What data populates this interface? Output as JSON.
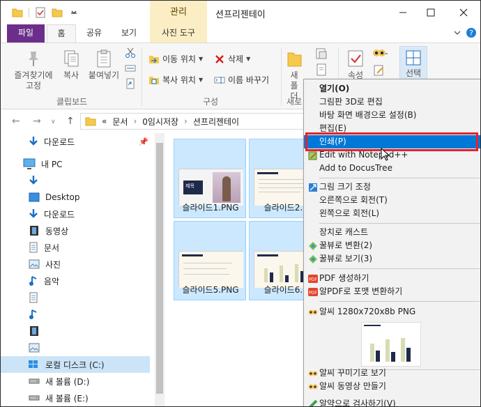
{
  "window": {
    "title": "션프리젠테이",
    "context_tab_group": "관리"
  },
  "tabs": [
    {
      "label": "파일"
    },
    {
      "label": "홈"
    },
    {
      "label": "공유"
    },
    {
      "label": "보기"
    },
    {
      "label": "사진 도구"
    }
  ],
  "ribbon": {
    "pin_label": "즐겨찾기에 고정",
    "copy_label": "복사",
    "paste_label": "붙여넣기",
    "clipboard_group": "클립보드",
    "move_label": "이동 위치",
    "copyto_label": "복사 위치",
    "delete_label": "삭제",
    "rename_label": "이름 바꾸기",
    "organize_group": "구성",
    "newfolder_label": "새 폴더",
    "new_group": "새로",
    "properties_label": "속성",
    "select_label": "선택"
  },
  "address": {
    "overflow": "«",
    "crumbs": [
      "문서",
      "0임시저장",
      "션프리젠테이"
    ]
  },
  "nav": {
    "items": [
      {
        "label": "다운로드"
      },
      {
        "label": "내 PC"
      },
      {
        "label": ""
      },
      {
        "label": "Desktop"
      },
      {
        "label": "다운로드"
      },
      {
        "label": "동영상"
      },
      {
        "label": "문서"
      },
      {
        "label": "사진"
      },
      {
        "label": "음악"
      },
      {
        "label": ""
      },
      {
        "label": ""
      },
      {
        "label": ""
      },
      {
        "label": ""
      },
      {
        "label": "로컬 디스크 (C:)"
      },
      {
        "label": "새 볼륨 (D:)"
      },
      {
        "label": "새 볼륨 (E:)"
      }
    ]
  },
  "files": [
    {
      "name": "슬라이드1.PNG"
    },
    {
      "name": "슬라이드2.P"
    },
    {
      "name": "슬라이드5.PNG"
    },
    {
      "name": "슬라이드6.P"
    }
  ],
  "thumb_text": {
    "slide1_title": "제목"
  },
  "context_menu": {
    "items": [
      "열기(O)",
      "그림판 3D로 편집",
      "바탕 화면 배경으로 설정(B)",
      "편집(E)",
      "인쇄(P)",
      "Edit with Notepad++",
      "Add to DocusTree",
      "그림 크기 조정",
      "오른쪽으로 회전(T)",
      "왼쪽으로 회전(L)",
      "장치로 캐스트",
      "꿀뷰로 변환(2)",
      "꿀뷰로 보기(3)",
      "PDF 생성하기",
      "알PDF로 포맷 변환하기",
      "알씨 1280x720x8b PNG",
      "알씨 꾸미기로 보기",
      "알씨 동영상 만들기",
      "알약으로 검사하기(V)"
    ],
    "highlighted_index": 4
  },
  "colors": {
    "accent": "#0078d7",
    "file_tab": "#6b2f8b",
    "context_tab": "#fbeec5",
    "selection": "#cce8ff",
    "annotation_box": "#e8202a"
  }
}
